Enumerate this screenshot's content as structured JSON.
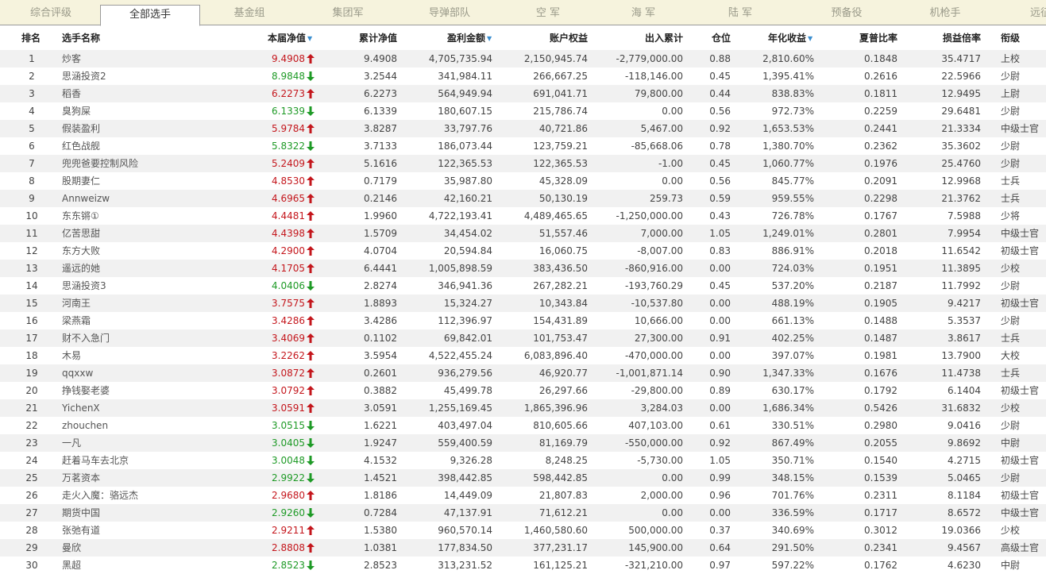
{
  "tabs": [
    {
      "label": "综合评级",
      "active": false
    },
    {
      "label": "全部选手",
      "active": true
    },
    {
      "label": "基金组",
      "active": false
    },
    {
      "label": "集团军",
      "active": false
    },
    {
      "label": "导弹部队",
      "active": false
    },
    {
      "label": "空 军",
      "active": false
    },
    {
      "label": "海 军",
      "active": false
    },
    {
      "label": "陆 军",
      "active": false
    },
    {
      "label": "预备役",
      "active": false
    },
    {
      "label": "机枪手",
      "active": false
    },
    {
      "label": "远征",
      "active": false
    }
  ],
  "columns": {
    "rank": "排名",
    "name": "选手名称",
    "nav": "本届净值",
    "cum_nav": "累计净值",
    "profit": "盈利金额",
    "equity": "账户权益",
    "flow": "出入累计",
    "position": "仓位",
    "annual": "年化收益",
    "sharpe": "夏普比率",
    "ratio": "损益倍率",
    "title": "衔级"
  },
  "sort_icon": "sort-down-triangle",
  "colors": {
    "up": "#c4161c",
    "down": "#1e9a26",
    "accent": "#3a8ecf",
    "tabbar": "#f6f3dd",
    "stripe": "#f1f1f1"
  },
  "rows": [
    {
      "rank": "1",
      "name": "炒客",
      "nav": "9.4908",
      "trend": "up",
      "cum_nav": "9.4908",
      "profit": "4,705,735.94",
      "equity": "2,150,945.74",
      "flow": "-2,779,000.00",
      "position": "0.88",
      "annual": "2,810.60%",
      "sharpe": "0.1848",
      "ratio": "35.4717",
      "title": "上校"
    },
    {
      "rank": "2",
      "name": "思涵投资2",
      "nav": "8.9848",
      "trend": "down",
      "cum_nav": "3.2544",
      "profit": "341,984.11",
      "equity": "266,667.25",
      "flow": "-118,146.00",
      "position": "0.45",
      "annual": "1,395.41%",
      "sharpe": "0.2616",
      "ratio": "22.5966",
      "title": "少尉"
    },
    {
      "rank": "3",
      "name": "稻香",
      "nav": "6.2273",
      "trend": "up",
      "cum_nav": "6.2273",
      "profit": "564,949.94",
      "equity": "691,041.71",
      "flow": "79,800.00",
      "position": "0.44",
      "annual": "838.83%",
      "sharpe": "0.1811",
      "ratio": "12.9495",
      "title": "上尉"
    },
    {
      "rank": "4",
      "name": "臭狗屎",
      "nav": "6.1339",
      "trend": "down",
      "cum_nav": "6.1339",
      "profit": "180,607.15",
      "equity": "215,786.74",
      "flow": "0.00",
      "position": "0.56",
      "annual": "972.73%",
      "sharpe": "0.2259",
      "ratio": "29.6481",
      "title": "少尉"
    },
    {
      "rank": "5",
      "name": "假装盈利",
      "nav": "5.9784",
      "trend": "up",
      "cum_nav": "3.8287",
      "profit": "33,797.76",
      "equity": "40,721.86",
      "flow": "5,467.00",
      "position": "0.92",
      "annual": "1,653.53%",
      "sharpe": "0.2441",
      "ratio": "21.3334",
      "title": "中级士官"
    },
    {
      "rank": "6",
      "name": "红色战舰",
      "nav": "5.8322",
      "trend": "down",
      "cum_nav": "3.7133",
      "profit": "186,073.44",
      "equity": "123,759.21",
      "flow": "-85,668.06",
      "position": "0.78",
      "annual": "1,380.70%",
      "sharpe": "0.2362",
      "ratio": "35.3602",
      "title": "少尉"
    },
    {
      "rank": "7",
      "name": "兜兜爸要控制风险",
      "nav": "5.2409",
      "trend": "up",
      "cum_nav": "5.1616",
      "profit": "122,365.53",
      "equity": "122,365.53",
      "flow": "-1.00",
      "position": "0.45",
      "annual": "1,060.77%",
      "sharpe": "0.1976",
      "ratio": "25.4760",
      "title": "少尉"
    },
    {
      "rank": "8",
      "name": "股期妻仁",
      "nav": "4.8530",
      "trend": "up",
      "cum_nav": "0.7179",
      "profit": "35,987.80",
      "equity": "45,328.09",
      "flow": "0.00",
      "position": "0.56",
      "annual": "845.77%",
      "sharpe": "0.2091",
      "ratio": "12.9968",
      "title": "士兵"
    },
    {
      "rank": "9",
      "name": "Annweizw",
      "nav": "4.6965",
      "trend": "up",
      "cum_nav": "0.2146",
      "profit": "42,160.21",
      "equity": "50,130.19",
      "flow": "259.73",
      "position": "0.59",
      "annual": "959.55%",
      "sharpe": "0.2298",
      "ratio": "21.3762",
      "title": "士兵"
    },
    {
      "rank": "10",
      "name": "东东锵①",
      "nav": "4.4481",
      "trend": "up",
      "cum_nav": "1.9960",
      "profit": "4,722,193.41",
      "equity": "4,489,465.65",
      "flow": "-1,250,000.00",
      "position": "0.43",
      "annual": "726.78%",
      "sharpe": "0.1767",
      "ratio": "7.5988",
      "title": "少将"
    },
    {
      "rank": "11",
      "name": "亿苦思甜",
      "nav": "4.4398",
      "trend": "up",
      "cum_nav": "1.5709",
      "profit": "34,454.02",
      "equity": "51,557.46",
      "flow": "7,000.00",
      "position": "1.05",
      "annual": "1,249.01%",
      "sharpe": "0.2801",
      "ratio": "7.9954",
      "title": "中级士官"
    },
    {
      "rank": "12",
      "name": "东方大败",
      "nav": "4.2900",
      "trend": "up",
      "cum_nav": "4.0704",
      "profit": "20,594.84",
      "equity": "16,060.75",
      "flow": "-8,007.00",
      "position": "0.83",
      "annual": "886.91%",
      "sharpe": "0.2018",
      "ratio": "11.6542",
      "title": "初级士官"
    },
    {
      "rank": "13",
      "name": "遥远的她",
      "nav": "4.1705",
      "trend": "up",
      "cum_nav": "6.4441",
      "profit": "1,005,898.59",
      "equity": "383,436.50",
      "flow": "-860,916.00",
      "position": "0.00",
      "annual": "724.03%",
      "sharpe": "0.1951",
      "ratio": "11.3895",
      "title": "少校"
    },
    {
      "rank": "14",
      "name": "思涵投资3",
      "nav": "4.0406",
      "trend": "down",
      "cum_nav": "2.8274",
      "profit": "346,941.36",
      "equity": "267,282.21",
      "flow": "-193,760.29",
      "position": "0.45",
      "annual": "537.20%",
      "sharpe": "0.2187",
      "ratio": "11.7992",
      "title": "少尉"
    },
    {
      "rank": "15",
      "name": "河南王",
      "nav": "3.7575",
      "trend": "up",
      "cum_nav": "1.8893",
      "profit": "15,324.27",
      "equity": "10,343.84",
      "flow": "-10,537.80",
      "position": "0.00",
      "annual": "488.19%",
      "sharpe": "0.1905",
      "ratio": "9.4217",
      "title": "初级士官"
    },
    {
      "rank": "16",
      "name": "梁燕霜",
      "nav": "3.4286",
      "trend": "up",
      "cum_nav": "3.4286",
      "profit": "112,396.97",
      "equity": "154,431.89",
      "flow": "10,666.00",
      "position": "0.00",
      "annual": "661.13%",
      "sharpe": "0.1488",
      "ratio": "5.3537",
      "title": "少尉"
    },
    {
      "rank": "17",
      "name": "财不入急门",
      "nav": "3.4069",
      "trend": "up",
      "cum_nav": "0.1102",
      "profit": "69,842.01",
      "equity": "101,753.47",
      "flow": "27,300.00",
      "position": "0.91",
      "annual": "402.25%",
      "sharpe": "0.1487",
      "ratio": "3.8617",
      "title": "士兵"
    },
    {
      "rank": "18",
      "name": "木易",
      "nav": "3.2262",
      "trend": "up",
      "cum_nav": "3.5954",
      "profit": "4,522,455.24",
      "equity": "6,083,896.40",
      "flow": "-470,000.00",
      "position": "0.00",
      "annual": "397.07%",
      "sharpe": "0.1981",
      "ratio": "13.7900",
      "title": "大校"
    },
    {
      "rank": "19",
      "name": "qqxxw",
      "nav": "3.0872",
      "trend": "up",
      "cum_nav": "0.2601",
      "profit": "936,279.56",
      "equity": "46,920.77",
      "flow": "-1,001,871.14",
      "position": "0.90",
      "annual": "1,347.33%",
      "sharpe": "0.1676",
      "ratio": "11.4738",
      "title": "士兵"
    },
    {
      "rank": "20",
      "name": "挣钱娶老婆",
      "nav": "3.0792",
      "trend": "up",
      "cum_nav": "0.3882",
      "profit": "45,499.78",
      "equity": "26,297.66",
      "flow": "-29,800.00",
      "position": "0.89",
      "annual": "630.17%",
      "sharpe": "0.1792",
      "ratio": "6.1404",
      "title": "初级士官"
    },
    {
      "rank": "21",
      "name": "YichenX",
      "nav": "3.0591",
      "trend": "up",
      "cum_nav": "3.0591",
      "profit": "1,255,169.45",
      "equity": "1,865,396.96",
      "flow": "3,284.03",
      "position": "0.00",
      "annual": "1,686.34%",
      "sharpe": "0.5426",
      "ratio": "31.6832",
      "title": "少校"
    },
    {
      "rank": "22",
      "name": "zhouchen",
      "nav": "3.0515",
      "trend": "down",
      "cum_nav": "1.6221",
      "profit": "403,497.04",
      "equity": "810,605.66",
      "flow": "407,103.00",
      "position": "0.61",
      "annual": "330.51%",
      "sharpe": "0.2980",
      "ratio": "9.0416",
      "title": "少尉"
    },
    {
      "rank": "23",
      "name": "一凡",
      "nav": "3.0405",
      "trend": "down",
      "cum_nav": "1.9247",
      "profit": "559,400.59",
      "equity": "81,169.79",
      "flow": "-550,000.00",
      "position": "0.92",
      "annual": "867.49%",
      "sharpe": "0.2055",
      "ratio": "9.8692",
      "title": "中尉"
    },
    {
      "rank": "24",
      "name": "赶着马车去北京",
      "nav": "3.0048",
      "trend": "down",
      "cum_nav": "4.1532",
      "profit": "9,326.28",
      "equity": "8,248.25",
      "flow": "-5,730.00",
      "position": "1.05",
      "annual": "350.71%",
      "sharpe": "0.1540",
      "ratio": "4.2715",
      "title": "初级士官"
    },
    {
      "rank": "25",
      "name": "万茗资本",
      "nav": "2.9922",
      "trend": "down",
      "cum_nav": "1.4521",
      "profit": "398,442.85",
      "equity": "598,442.85",
      "flow": "0.00",
      "position": "0.99",
      "annual": "348.15%",
      "sharpe": "0.1539",
      "ratio": "5.0465",
      "title": "少尉"
    },
    {
      "rank": "26",
      "name": "走火入魔：骆远杰",
      "nav": "2.9680",
      "trend": "up",
      "cum_nav": "1.8186",
      "profit": "14,449.09",
      "equity": "21,807.83",
      "flow": "2,000.00",
      "position": "0.96",
      "annual": "701.76%",
      "sharpe": "0.2311",
      "ratio": "8.1184",
      "title": "初级士官"
    },
    {
      "rank": "27",
      "name": "期货中国",
      "nav": "2.9260",
      "trend": "down",
      "cum_nav": "0.7284",
      "profit": "47,137.91",
      "equity": "71,612.21",
      "flow": "0.00",
      "position": "0.00",
      "annual": "336.59%",
      "sharpe": "0.1717",
      "ratio": "8.6572",
      "title": "中级士官"
    },
    {
      "rank": "28",
      "name": "张弛有道",
      "nav": "2.9211",
      "trend": "up",
      "cum_nav": "1.5380",
      "profit": "960,570.14",
      "equity": "1,460,580.60",
      "flow": "500,000.00",
      "position": "0.37",
      "annual": "340.69%",
      "sharpe": "0.3012",
      "ratio": "19.0366",
      "title": "少校"
    },
    {
      "rank": "29",
      "name": "曼欣",
      "nav": "2.8808",
      "trend": "up",
      "cum_nav": "1.0381",
      "profit": "177,834.50",
      "equity": "377,231.17",
      "flow": "145,900.00",
      "position": "0.64",
      "annual": "291.50%",
      "sharpe": "0.2341",
      "ratio": "9.4567",
      "title": "高级士官"
    },
    {
      "rank": "30",
      "name": "黑超",
      "nav": "2.8523",
      "trend": "down",
      "cum_nav": "2.8523",
      "profit": "313,231.52",
      "equity": "161,125.21",
      "flow": "-321,210.00",
      "position": "0.97",
      "annual": "597.22%",
      "sharpe": "0.1762",
      "ratio": "4.6230",
      "title": "中尉"
    }
  ]
}
